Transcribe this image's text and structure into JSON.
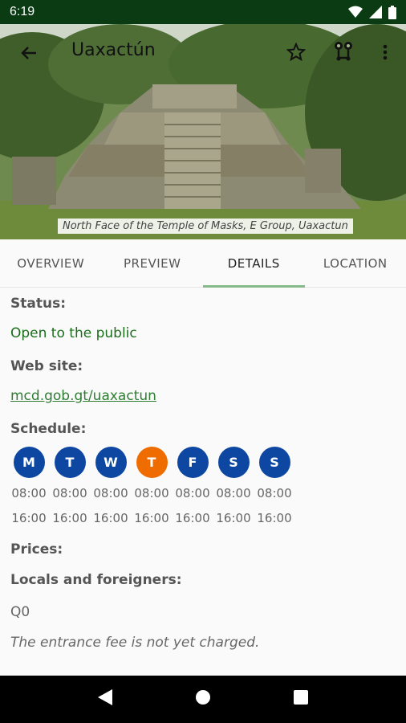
{
  "status_bar": {
    "time": "6:19"
  },
  "hero": {
    "title": "Uaxactún",
    "caption": "North Face of the Temple of Masks, E Group, Uaxactun"
  },
  "tabs": [
    {
      "label": "OVERVIEW",
      "active": false
    },
    {
      "label": "PREVIEW",
      "active": false
    },
    {
      "label": "DETAILS",
      "active": true
    },
    {
      "label": "LOCATION",
      "active": false
    }
  ],
  "details": {
    "status_label": "Status:",
    "status_value": "Open to the public",
    "website_label": "Web site:",
    "website_value": "mcd.gob.gt/uaxactun",
    "schedule_label": "Schedule:",
    "schedule": [
      {
        "day": "M",
        "open": "08:00",
        "close": "16:00",
        "today": false
      },
      {
        "day": "T",
        "open": "08:00",
        "close": "16:00",
        "today": false
      },
      {
        "day": "W",
        "open": "08:00",
        "close": "16:00",
        "today": false
      },
      {
        "day": "T",
        "open": "08:00",
        "close": "16:00",
        "today": true
      },
      {
        "day": "F",
        "open": "08:00",
        "close": "16:00",
        "today": false
      },
      {
        "day": "S",
        "open": "08:00",
        "close": "16:00",
        "today": false
      },
      {
        "day": "S",
        "open": "08:00",
        "close": "16:00",
        "today": false
      }
    ],
    "prices_label": "Prices:",
    "price_group_label": "Locals and foreigners:",
    "price_value": "Q0",
    "price_note": "The entrance fee is not yet charged."
  },
  "colors": {
    "status_bar": "#0b3b12",
    "day_circle": "#0d47a1",
    "today_circle": "#ef6c00",
    "status_text": "#1b6e1b",
    "tab_indicator": "#86b98a"
  },
  "icons": [
    "back-arrow-icon",
    "star-outline-icon",
    "route-icon",
    "more-vert-icon",
    "wifi-icon",
    "signal-icon",
    "battery-icon",
    "nav-back-icon",
    "nav-home-icon",
    "nav-recents-icon"
  ]
}
